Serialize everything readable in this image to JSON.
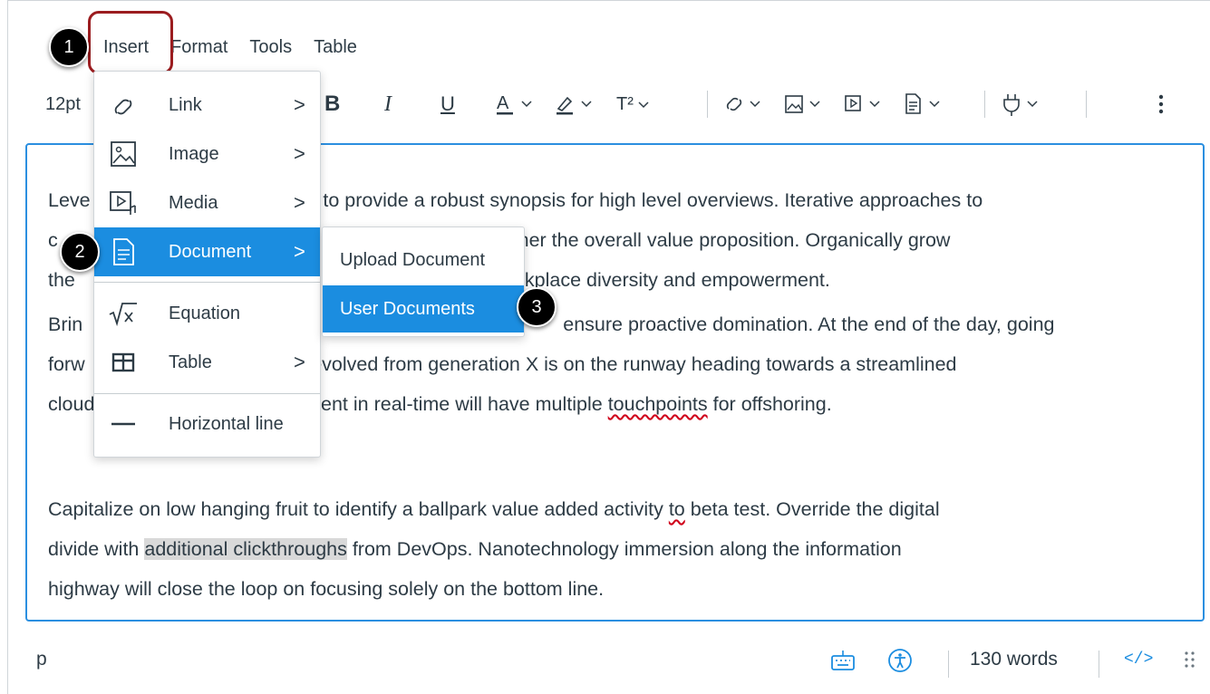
{
  "menubar": {
    "items": [
      "Insert",
      "Format",
      "Tools",
      "Table"
    ]
  },
  "toolbar": {
    "font_size": "12pt",
    "superscript_label": "T²"
  },
  "content": {
    "p1_before": "Leve",
    "p1_l1": "s to provide a robust synopsis for high level overviews. Iterative approaches to",
    "p1_l2_start": "c",
    "p1_l2": "ng to further the overall value proposition. Organically grow",
    "p1_l3_start": "the",
    "p1_l3": "on via workplace diversity and empowerment.",
    "p2_l1_start": "Brin",
    "p2_l1": "ensure proactive domination. At the end of the day, going",
    "p2_l2_start": "forw",
    "p2_l2": "t has evolved from generation X is on the runway heading towards a streamlined",
    "p2_l3_start": "cloud",
    "p2_l3_a": "rated content in real-time will have multiple ",
    "p2_l3_spell": "touchpoints",
    "p2_l3_b": " for offshoring.",
    "p3_l1_a": "Capitalize on low hanging fruit to identify a ballpark value added activity ",
    "p3_l1_spell": "to",
    "p3_l1_b": " beta test. Override the digital",
    "p3_l2_a": "divide with ",
    "p3_l2_hl": "additional clickthroughs",
    "p3_l2_b": " from DevOps. Nanotechnology immersion along the information",
    "p3_l3": "highway will close the loop on focusing solely on the bottom line."
  },
  "insert_menu": {
    "items": [
      {
        "label": "Link",
        "icon": "link-icon",
        "submenu": true
      },
      {
        "label": "Image",
        "icon": "image-icon",
        "submenu": true
      },
      {
        "label": "Media",
        "icon": "media-icon",
        "submenu": true
      },
      {
        "label": "Document",
        "icon": "document-icon",
        "submenu": true
      },
      {
        "label": "Equation",
        "icon": "equation-icon",
        "submenu": false
      },
      {
        "label": "Table",
        "icon": "table-icon",
        "submenu": true
      },
      {
        "label": "Horizontal line",
        "icon": "horizontal-line-icon",
        "submenu": false
      }
    ],
    "arrow": ">"
  },
  "document_submenu": {
    "items": [
      "Upload Document",
      "User Documents"
    ]
  },
  "status_bar": {
    "path": "p",
    "word_count": "130 words",
    "html_toggle": "</>"
  },
  "badges": [
    "1",
    "2",
    "3"
  ],
  "colors": {
    "accent": "#1b8de0",
    "editor_border": "#2b8fe0",
    "highlight_outline": "#9b1c1f",
    "text": "#2d3b45"
  }
}
